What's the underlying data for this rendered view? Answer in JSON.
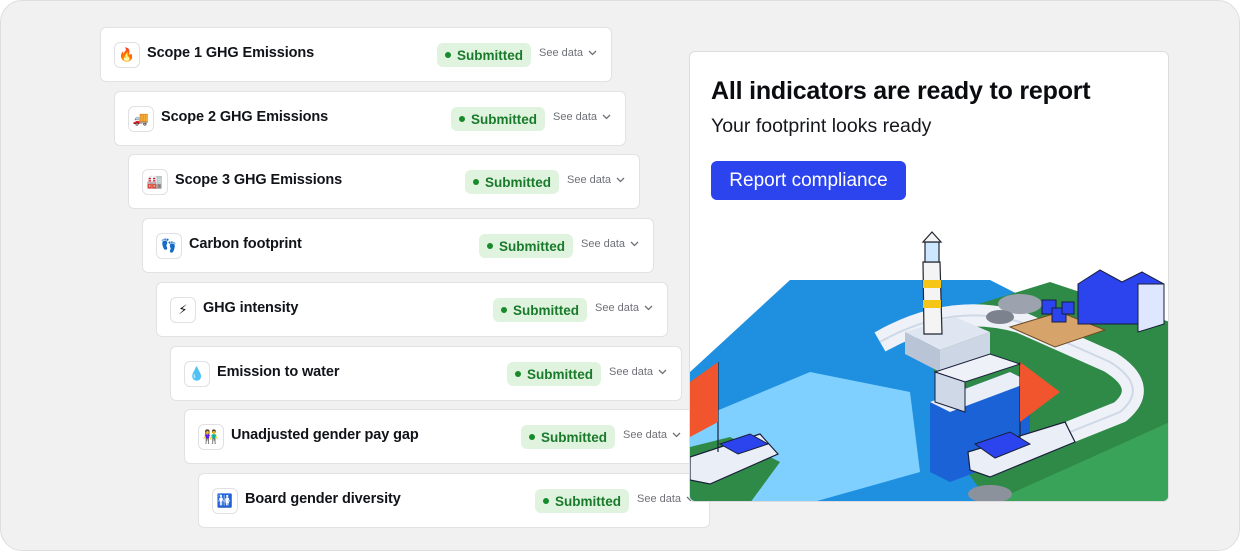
{
  "indicators": [
    {
      "icon": "fire-icon",
      "glyph": "🔥",
      "title": "Scope 1 GHG Emissions",
      "status": "Submitted",
      "action": "See data"
    },
    {
      "icon": "truck-icon",
      "glyph": "🚚",
      "title": "Scope 2 GHG Emissions",
      "status": "Submitted",
      "action": "See data"
    },
    {
      "icon": "factory-icon",
      "glyph": "🏭",
      "title": "Scope 3 GHG Emissions",
      "status": "Submitted",
      "action": "See data"
    },
    {
      "icon": "footprint-icon",
      "glyph": "👣",
      "title": "Carbon footprint",
      "status": "Submitted",
      "action": "See data"
    },
    {
      "icon": "lightning-icon",
      "glyph": "⚡",
      "title": "GHG intensity",
      "status": "Submitted",
      "action": "See data"
    },
    {
      "icon": "water-drop-icon",
      "glyph": "💧",
      "title": "Emission to water",
      "status": "Submitted",
      "action": "See data"
    },
    {
      "icon": "couple-icon",
      "glyph": "👫",
      "title": "Unadjusted gender pay gap",
      "status": "Submitted",
      "action": "See data"
    },
    {
      "icon": "gender-icon",
      "glyph": "🚻",
      "title": "Board gender diversity",
      "status": "Submitted",
      "action": "See data"
    }
  ],
  "report_card": {
    "heading": "All indicators are ready to report",
    "subheading": "Your footprint looks ready",
    "button_label": "Report compliance",
    "illustration": "harbor-lighthouse-illustration"
  },
  "colors": {
    "accent": "#2b44ee",
    "status_bg": "#dff3de",
    "status_text": "#1a7a2b",
    "page_bg": "#f1f1f2"
  }
}
